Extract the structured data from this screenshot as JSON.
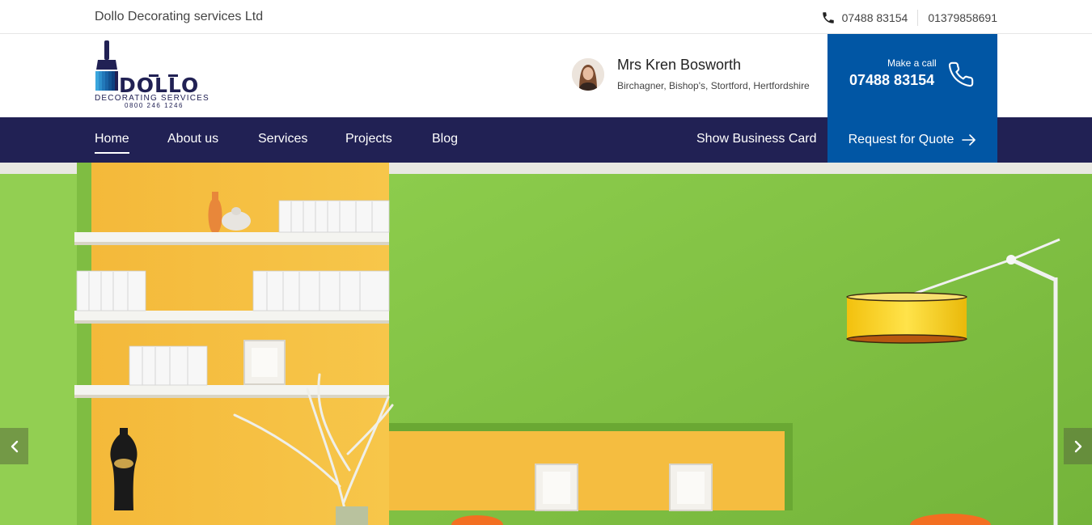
{
  "topbar": {
    "company_name": "Dollo Decorating services Ltd",
    "phone_1": "07488 83154",
    "phone_2": "01379858691",
    "phone_icon": "phone-icon"
  },
  "logo": {
    "text": "DOLLO",
    "subtitle": "DECORATING SERVICES",
    "number": "0800 246 1246",
    "colors": {
      "navy": "#212154",
      "blue": "#0156a4",
      "light_blue": "#3aa6dd"
    }
  },
  "contact": {
    "name": "Mrs Kren Bosworth",
    "location": "Birchagner, Bishop's, Stortford, Hertfordshire"
  },
  "call_box": {
    "label": "Make a call",
    "number": "07488 83154",
    "icon": "phone-outline-icon",
    "color": "#0156a4"
  },
  "nav": {
    "items": [
      {
        "label": "Home",
        "active": true
      },
      {
        "label": "About us"
      },
      {
        "label": "Services"
      },
      {
        "label": "Projects"
      },
      {
        "label": "Blog"
      }
    ],
    "business_card": "Show Business Card",
    "quote_button": "Request for Quote",
    "background": "#212154"
  },
  "hero": {
    "prev_icon": "chevron-left-icon",
    "next_icon": "chevron-right-icon",
    "colors": {
      "green": "#87c44a",
      "yellow": "#f6c33c",
      "lamp": "#f7d21c"
    }
  }
}
